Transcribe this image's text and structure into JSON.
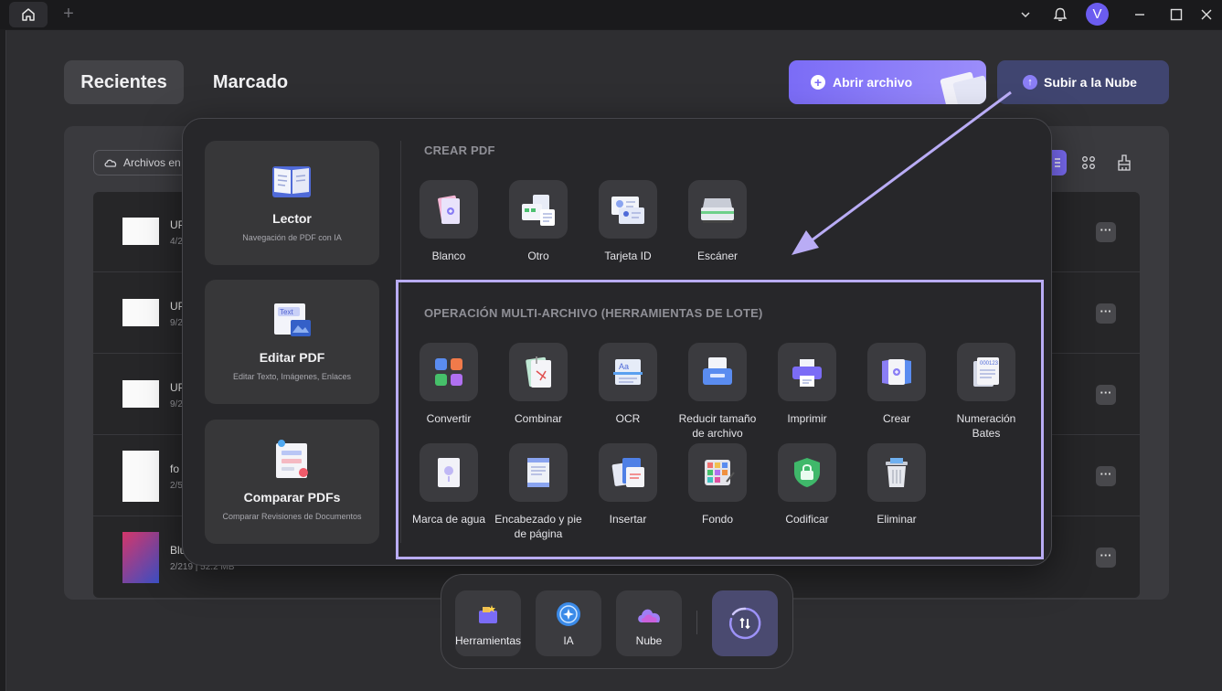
{
  "header": {
    "avatar_letter": "V"
  },
  "tabs": {
    "recent": "Recientes",
    "marked": "Marcado"
  },
  "actions": {
    "open_file": "Abrir archivo",
    "upload_cloud": "Subir a la Nube"
  },
  "filter": {
    "chip_label": "Archivos en"
  },
  "files": [
    {
      "name": "UP",
      "meta": "4/2"
    },
    {
      "name": "UP",
      "meta": "9/2"
    },
    {
      "name": "UP",
      "meta": "9/2"
    },
    {
      "name": "fo",
      "meta": "2/5"
    },
    {
      "name": "Blu",
      "meta": "2/219 | 52.2 MB"
    }
  ],
  "popup": {
    "cards": [
      {
        "title": "Lector",
        "subtitle": "Navegación de PDF con IA"
      },
      {
        "title": "Editar PDF",
        "subtitle": "Editar Texto, Imágenes, Enlaces"
      },
      {
        "title": "Comparar PDFs",
        "subtitle": "Comparar Revisiones de Documentos"
      }
    ],
    "create_title": "CREAR PDF",
    "create_tools": [
      "Blanco",
      "Otro",
      "Tarjeta ID",
      "Escáner"
    ],
    "batch_title": "OPERACIÓN MULTI-ARCHIVO (HERRAMIENTAS DE LOTE)",
    "batch_row1": [
      "Convertir",
      "Combinar",
      "OCR",
      "Reducir tamaño de archivo",
      "Imprimir",
      "Crear",
      "Numeración Bates"
    ],
    "batch_row2": [
      "Marca de agua",
      "Encabezado y pie de página",
      "Insertar",
      "Fondo",
      "Codificar",
      "Eliminar"
    ]
  },
  "dock": {
    "tools": "Herramientas",
    "ai": "IA",
    "cloud": "Nube"
  },
  "colors": {
    "accent": "#7b6cf6",
    "highlight": "#b9acf5",
    "background": "#2e2e31"
  }
}
